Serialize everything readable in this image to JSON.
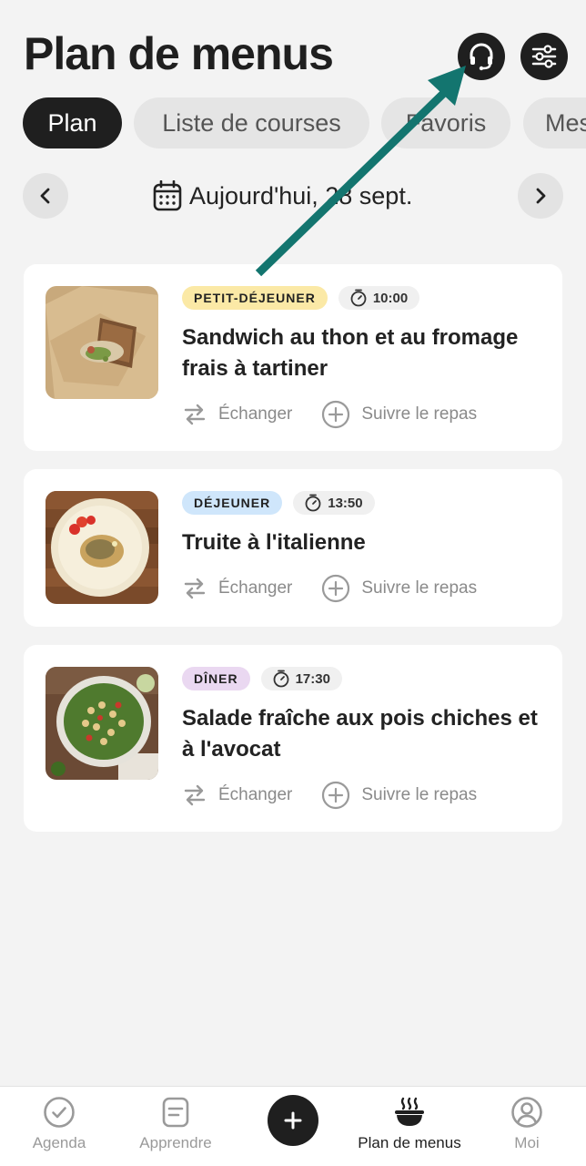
{
  "header": {
    "title": "Plan de menus",
    "support_icon": "headset-icon",
    "filter_icon": "sliders-icon"
  },
  "tabs": [
    {
      "label": "Plan",
      "active": true
    },
    {
      "label": "Liste de courses",
      "active": false
    },
    {
      "label": "Favoris",
      "active": false
    },
    {
      "label": "Mes",
      "active": false
    }
  ],
  "date_nav": {
    "prev_icon": "chevron-left-icon",
    "next_icon": "chevron-right-icon",
    "calendar_icon": "calendar-icon",
    "label": "Aujourd'hui, 28 sept."
  },
  "meals": [
    {
      "type": "PETIT-DÉJEUNER",
      "type_color": "#fbe9a6",
      "time": "10:00",
      "title_line1": "Sandwich au thon et au fromage",
      "title_line2": "frais à tartiner",
      "swap_label": "Échanger",
      "track_label": "Suivre le repas"
    },
    {
      "type": "DÉJEUNER",
      "type_color": "#cfe6fb",
      "time": "13:50",
      "title_line1": "Truite à l'italienne",
      "title_line2": "",
      "swap_label": "Échanger",
      "track_label": "Suivre le repas"
    },
    {
      "type": "DÎNER",
      "type_color": "#ead8f1",
      "time": "17:30",
      "title_line1": "Salade fraîche aux pois chiches et",
      "title_line2": "à l'avocat",
      "swap_label": "Échanger",
      "track_label": "Suivre le repas"
    }
  ],
  "annotation": {
    "arrow_color": "#13756f"
  },
  "bottom_nav": [
    {
      "label": "Agenda",
      "icon": "check-circle-icon",
      "active": false
    },
    {
      "label": "Apprendre",
      "icon": "note-icon",
      "active": false
    },
    {
      "label": "",
      "icon": "plus-icon",
      "active": false
    },
    {
      "label": "Plan de menus",
      "icon": "steaming-bowl-icon",
      "active": true
    },
    {
      "label": "Moi",
      "icon": "profile-icon",
      "active": false
    }
  ]
}
